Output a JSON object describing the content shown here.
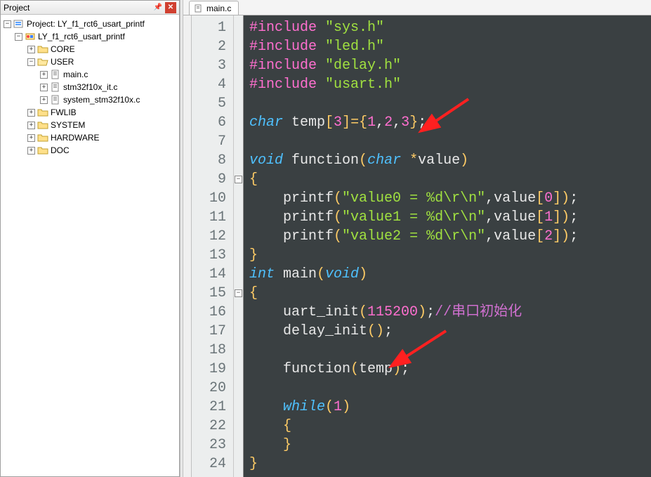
{
  "panel": {
    "title": "Project"
  },
  "tree": {
    "root": {
      "label": "Project: LY_f1_rct6_usart_printf"
    },
    "target": {
      "label": "LY_f1_rct6_usart_printf"
    },
    "folders": {
      "core": "CORE",
      "user": "USER",
      "fwlib": "FWLIB",
      "system": "SYSTEM",
      "hardware": "HARDWARE",
      "doc": "DOC"
    },
    "user_files": {
      "main": "main.c",
      "it": "stm32f10x_it.c",
      "sys": "system_stm32f10x.c"
    }
  },
  "tab": {
    "filename": "main.c"
  },
  "code": {
    "lines": [
      {
        "n": 1,
        "seg": [
          [
            "pp",
            "#include "
          ],
          [
            "str",
            "\"sys.h\""
          ]
        ]
      },
      {
        "n": 2,
        "seg": [
          [
            "pp",
            "#include "
          ],
          [
            "str",
            "\"led.h\""
          ]
        ]
      },
      {
        "n": 3,
        "seg": [
          [
            "pp",
            "#include "
          ],
          [
            "str",
            "\"delay.h\""
          ]
        ]
      },
      {
        "n": 4,
        "seg": [
          [
            "pp",
            "#include "
          ],
          [
            "str",
            "\"usart.h\""
          ]
        ]
      },
      {
        "n": 5,
        "seg": []
      },
      {
        "n": 6,
        "seg": [
          [
            "type",
            "char"
          ],
          [
            "id",
            " temp"
          ],
          [
            "op",
            "["
          ],
          [
            "num",
            "3"
          ],
          [
            "op",
            "]"
          ],
          [
            "op",
            "="
          ],
          [
            "brace",
            "{"
          ],
          [
            "num",
            "1"
          ],
          [
            "punc",
            ","
          ],
          [
            "num",
            "2"
          ],
          [
            "punc",
            ","
          ],
          [
            "num",
            "3"
          ],
          [
            "brace",
            "}"
          ],
          [
            "punc",
            ";"
          ]
        ]
      },
      {
        "n": 7,
        "seg": []
      },
      {
        "n": 8,
        "seg": [
          [
            "type",
            "void"
          ],
          [
            "id",
            " function"
          ],
          [
            "paren",
            "("
          ],
          [
            "type",
            "char"
          ],
          [
            "id",
            " "
          ],
          [
            "op",
            "*"
          ],
          [
            "id",
            "value"
          ],
          [
            "paren",
            ")"
          ]
        ]
      },
      {
        "n": 9,
        "seg": [
          [
            "brace",
            "{"
          ]
        ],
        "fold": true
      },
      {
        "n": 10,
        "seg": [
          [
            "id",
            "    printf"
          ],
          [
            "paren",
            "("
          ],
          [
            "str",
            "\"value0 = %d\\r\\n\""
          ],
          [
            "punc",
            ","
          ],
          [
            "id",
            "value"
          ],
          [
            "op",
            "["
          ],
          [
            "num",
            "0"
          ],
          [
            "op",
            "]"
          ],
          [
            "paren",
            ")"
          ],
          [
            "punc",
            ";"
          ]
        ]
      },
      {
        "n": 11,
        "seg": [
          [
            "id",
            "    printf"
          ],
          [
            "paren",
            "("
          ],
          [
            "str",
            "\"value1 = %d\\r\\n\""
          ],
          [
            "punc",
            ","
          ],
          [
            "id",
            "value"
          ],
          [
            "op",
            "["
          ],
          [
            "num",
            "1"
          ],
          [
            "op",
            "]"
          ],
          [
            "paren",
            ")"
          ],
          [
            "punc",
            ";"
          ]
        ]
      },
      {
        "n": 12,
        "seg": [
          [
            "id",
            "    printf"
          ],
          [
            "paren",
            "("
          ],
          [
            "str",
            "\"value2 = %d\\r\\n\""
          ],
          [
            "punc",
            ","
          ],
          [
            "id",
            "value"
          ],
          [
            "op",
            "["
          ],
          [
            "num",
            "2"
          ],
          [
            "op",
            "]"
          ],
          [
            "paren",
            ")"
          ],
          [
            "punc",
            ";"
          ]
        ]
      },
      {
        "n": 13,
        "seg": [
          [
            "brace",
            "}"
          ]
        ]
      },
      {
        "n": 14,
        "seg": [
          [
            "type",
            "int"
          ],
          [
            "id",
            " main"
          ],
          [
            "paren",
            "("
          ],
          [
            "type",
            "void"
          ],
          [
            "paren",
            ")"
          ]
        ]
      },
      {
        "n": 15,
        "seg": [
          [
            "brace",
            "{"
          ]
        ],
        "fold": true
      },
      {
        "n": 16,
        "seg": [
          [
            "id",
            "    uart_init"
          ],
          [
            "paren",
            "("
          ],
          [
            "num",
            "115200"
          ],
          [
            "paren",
            ")"
          ],
          [
            "punc",
            ";"
          ],
          [
            "cmt",
            "//串口初始化"
          ]
        ]
      },
      {
        "n": 17,
        "seg": [
          [
            "id",
            "    delay_init"
          ],
          [
            "paren",
            "("
          ],
          [
            "paren",
            ")"
          ],
          [
            "punc",
            ";"
          ]
        ]
      },
      {
        "n": 18,
        "seg": []
      },
      {
        "n": 19,
        "seg": [
          [
            "id",
            "    function"
          ],
          [
            "paren",
            "("
          ],
          [
            "id",
            "temp"
          ],
          [
            "paren",
            ")"
          ],
          [
            "punc",
            ";"
          ]
        ]
      },
      {
        "n": 20,
        "seg": []
      },
      {
        "n": 21,
        "seg": [
          [
            "id",
            "    "
          ],
          [
            "kw",
            "while"
          ],
          [
            "paren",
            "("
          ],
          [
            "num",
            "1"
          ],
          [
            "paren",
            ")"
          ]
        ]
      },
      {
        "n": 22,
        "seg": [
          [
            "id",
            "    "
          ],
          [
            "brace",
            "{"
          ]
        ]
      },
      {
        "n": 23,
        "seg": [
          [
            "id",
            "    "
          ],
          [
            "brace",
            "}"
          ]
        ]
      },
      {
        "n": 24,
        "seg": [
          [
            "brace",
            "}"
          ]
        ]
      }
    ]
  }
}
